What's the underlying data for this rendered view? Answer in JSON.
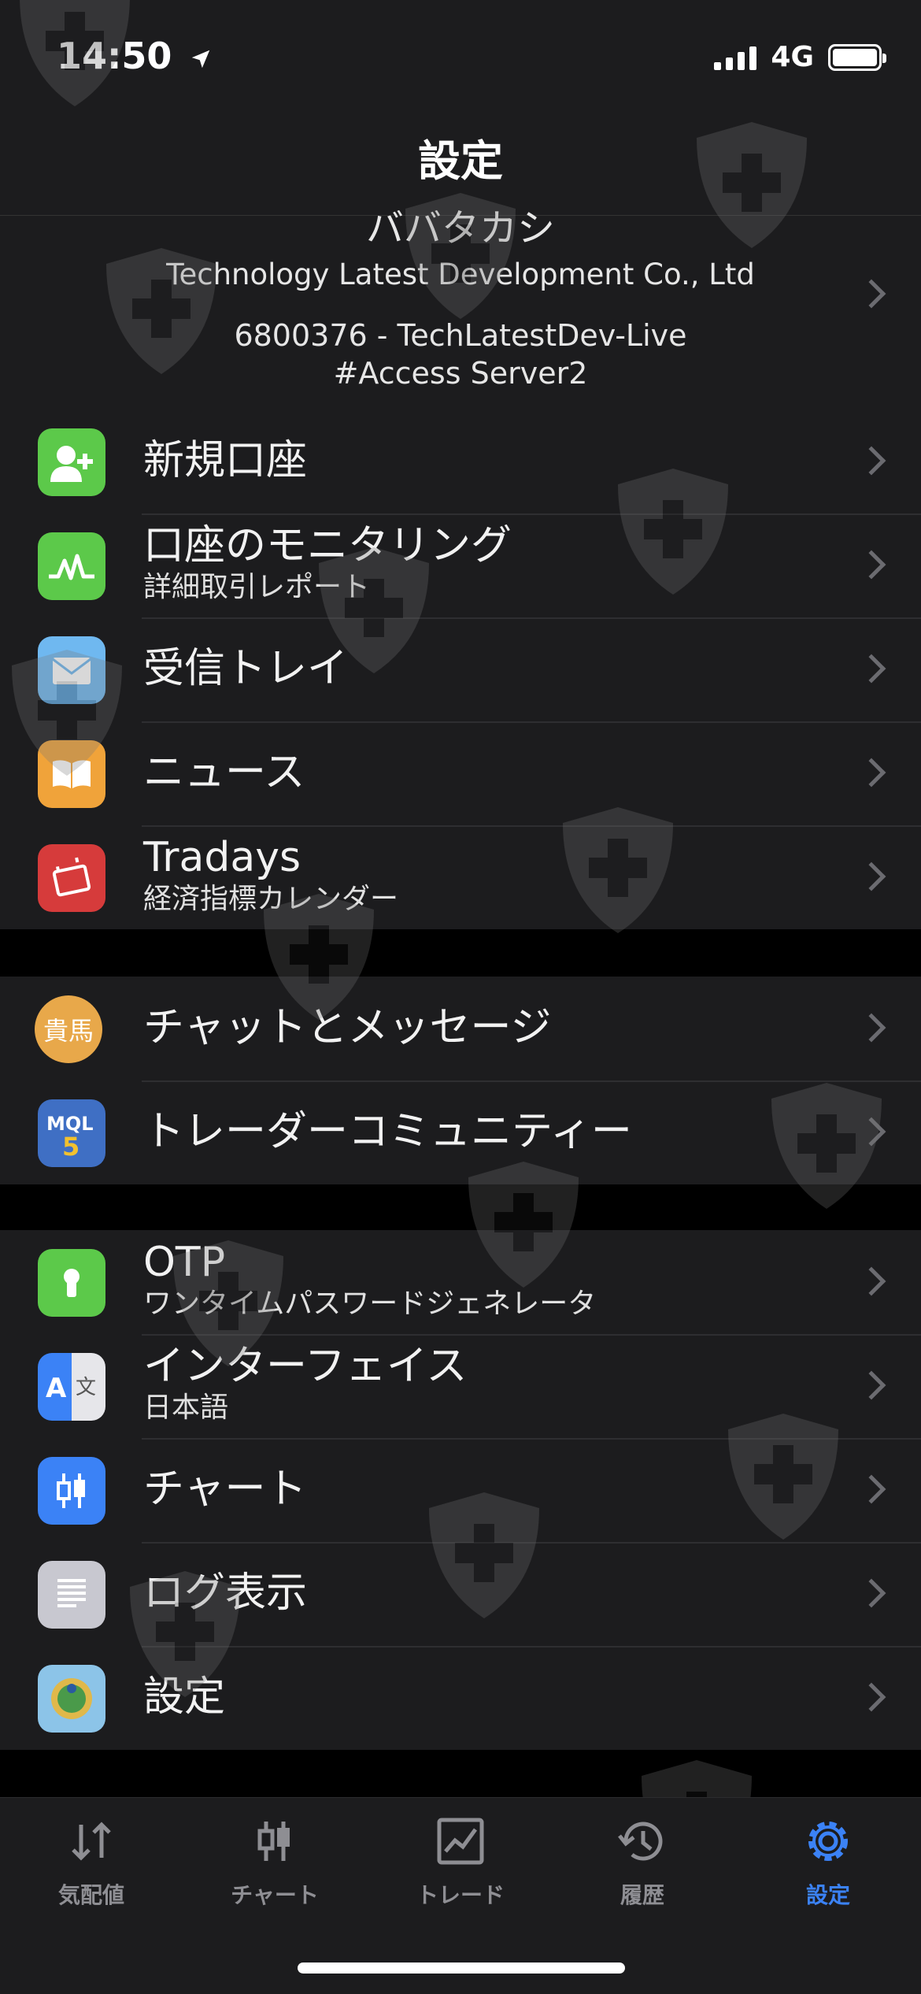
{
  "status": {
    "time": "14:50",
    "network": "4G"
  },
  "header": {
    "title": "設定"
  },
  "account": {
    "name": "ババタカシ",
    "company": "Technology Latest Development Co., Ltd",
    "login": "6800376 - TechLatestDev-Live",
    "server": "#Access Server2"
  },
  "section1": [
    {
      "title": "新規口座",
      "sub": ""
    },
    {
      "title": "口座のモニタリング",
      "sub": "詳細取引レポート"
    },
    {
      "title": "受信トレイ",
      "sub": ""
    },
    {
      "title": "ニュース",
      "sub": ""
    },
    {
      "title": "Tradays",
      "sub": "経済指標カレンダー"
    }
  ],
  "section2": [
    {
      "title": "チャットとメッセージ",
      "avatar_text": "貴馬"
    },
    {
      "title": "トレーダーコミュニティー"
    }
  ],
  "section3": [
    {
      "title": "OTP",
      "sub": "ワンタイムパスワードジェネレータ"
    },
    {
      "title": "インターフェイス",
      "sub": "日本語"
    },
    {
      "title": "チャート",
      "sub": ""
    },
    {
      "title": "ログ表示",
      "sub": ""
    },
    {
      "title": "設定",
      "sub": ""
    }
  ],
  "tabs": [
    {
      "label": "気配値",
      "icon": "arrows-updown-icon"
    },
    {
      "label": "チャート",
      "icon": "candles-icon"
    },
    {
      "label": "トレード",
      "icon": "trade-chart-icon"
    },
    {
      "label": "履歴",
      "icon": "history-icon"
    },
    {
      "label": "設定",
      "icon": "gear-icon",
      "active": true
    }
  ],
  "colors": {
    "accent": "#3b82f6",
    "new_account_icon": "#5cc94a",
    "monitoring_icon": "#5cc94a",
    "inbox_icon": "#6fb8f0",
    "news_icon": "#f0a33a",
    "tradays_icon": "#d63b3b",
    "mql5_icon": "#3f6fc4",
    "otp_icon": "#5cc94a",
    "chart_icon": "#3b82f6",
    "log_icon": "#c8c8d0"
  }
}
